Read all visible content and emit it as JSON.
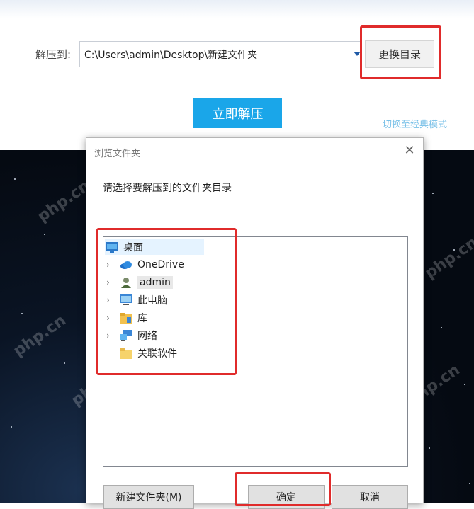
{
  "extract_panel": {
    "label": "解压到:",
    "path": "C:\\Users\\admin\\Desktop\\新建文件夹",
    "change_dir_button": "更换目录",
    "extract_now_button": "立即解压",
    "classic_mode_link": "切换至经典模式"
  },
  "dialog": {
    "title": "浏览文件夹",
    "instruction": "请选择要解压到的文件夹目录",
    "tree": [
      {
        "label": "桌面",
        "icon": "desktop-icon",
        "expandable": false
      },
      {
        "label": "OneDrive",
        "icon": "cloud-icon",
        "expandable": true
      },
      {
        "label": "admin",
        "icon": "user-icon",
        "expandable": true
      },
      {
        "label": "此电脑",
        "icon": "computer-icon",
        "expandable": true
      },
      {
        "label": "库",
        "icon": "library-icon",
        "expandable": true
      },
      {
        "label": "网络",
        "icon": "network-icon",
        "expandable": true
      },
      {
        "label": "关联软件",
        "icon": "folder-icon",
        "expandable": false
      }
    ],
    "new_folder_button": "新建文件夹(M)",
    "ok_button": "确定",
    "cancel_button": "取消"
  },
  "watermark_text": "php.cn",
  "colors": {
    "accent_blue": "#1aa6e9",
    "highlight_red": "#e02b2b"
  }
}
